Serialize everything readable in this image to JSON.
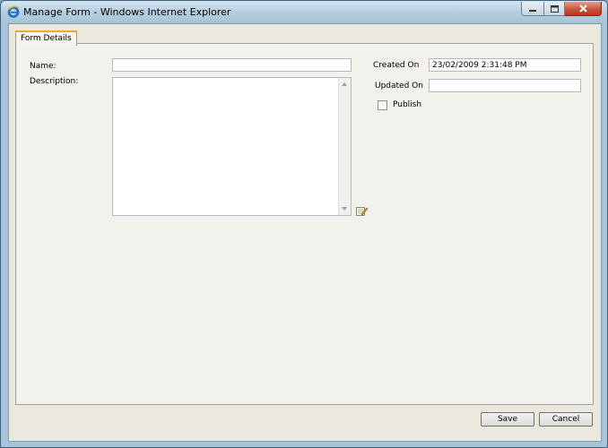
{
  "window": {
    "title": "Manage Form - Windows Internet Explorer",
    "icon": "ie-icon"
  },
  "tabs": [
    {
      "label": "Form Details",
      "active": true
    }
  ],
  "form": {
    "name_label": "Name:",
    "name_value": "",
    "description_label": "Description:",
    "description_value": "",
    "created_on_label": "Created On",
    "created_on_value": "23/02/2009 2:31:48 PM",
    "updated_on_label": "Updated On",
    "updated_on_value": "",
    "publish_label": "Publish",
    "publish_checked": false
  },
  "buttons": {
    "save_label": "Save",
    "cancel_label": "Cancel"
  },
  "colors": {
    "tab_accent": "#f0a830",
    "close_button": "#c9533c"
  }
}
